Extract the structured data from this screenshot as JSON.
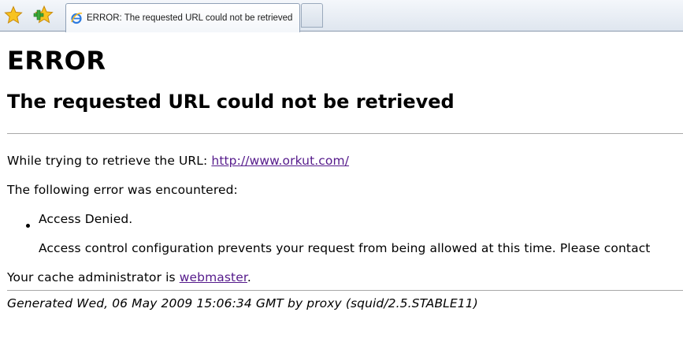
{
  "browser": {
    "tab_title": "ERROR: The requested URL could not be retrieved"
  },
  "page": {
    "heading": "ERROR",
    "subheading": "The requested URL could not be retrieved",
    "retrieve_prefix": "While trying to retrieve the URL: ",
    "url": "http://www.orkut.com/",
    "error_intro": "The following error was encountered:",
    "error_title": "Access Denied.",
    "error_detail": "Access control configuration prevents your request from being allowed at this time. Please contact",
    "admin_prefix": "Your cache administrator is ",
    "admin_link": "webmaster",
    "admin_suffix": ".",
    "generated": "Generated Wed, 06 May 2009 15:06:34 GMT by proxy (squid/2.5.STABLE11)"
  }
}
